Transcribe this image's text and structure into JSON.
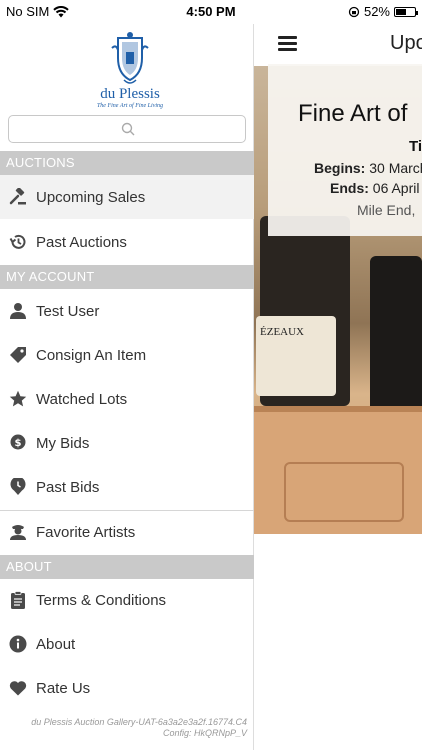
{
  "status": {
    "carrier": "No SIM",
    "time": "4:50 PM",
    "battery": "52%",
    "battery_level": 0.52
  },
  "topbar": {
    "title": "Upo"
  },
  "hero": {
    "title": "Fine Art of",
    "subtitle": "Ti",
    "begins_label": "Begins:",
    "begins_value": "30 March",
    "ends_label": "Ends:",
    "ends_value": "06 April",
    "location": "Mile End,",
    "bottle_label": "ÉZEAUX"
  },
  "drawer": {
    "logo_name": "du Plessis",
    "logo_tagline": "The Fine Art of Fine Living",
    "search_placeholder": "",
    "sections": {
      "auctions": "AUCTIONS",
      "account": "MY ACCOUNT",
      "about": "ABOUT"
    },
    "items": {
      "upcoming": "Upcoming Sales",
      "past_auctions": "Past Auctions",
      "test_user": "Test User",
      "consign": "Consign An Item",
      "watched": "Watched Lots",
      "my_bids": "My Bids",
      "past_bids": "Past Bids",
      "favorite_artists": "Favorite Artists",
      "terms": "Terms & Conditions",
      "about": "About",
      "rate": "Rate Us"
    },
    "footer_line1": "du Plessis Auction Gallery-UAT-6a3a2e3a2f.16774.C4",
    "footer_line2": "Config: HkQRNpP_V"
  },
  "colors": {
    "section_header_bg": "#c9c9c9",
    "brand_blue": "#1f5fa8",
    "icon_gray": "#4a4a4a"
  }
}
